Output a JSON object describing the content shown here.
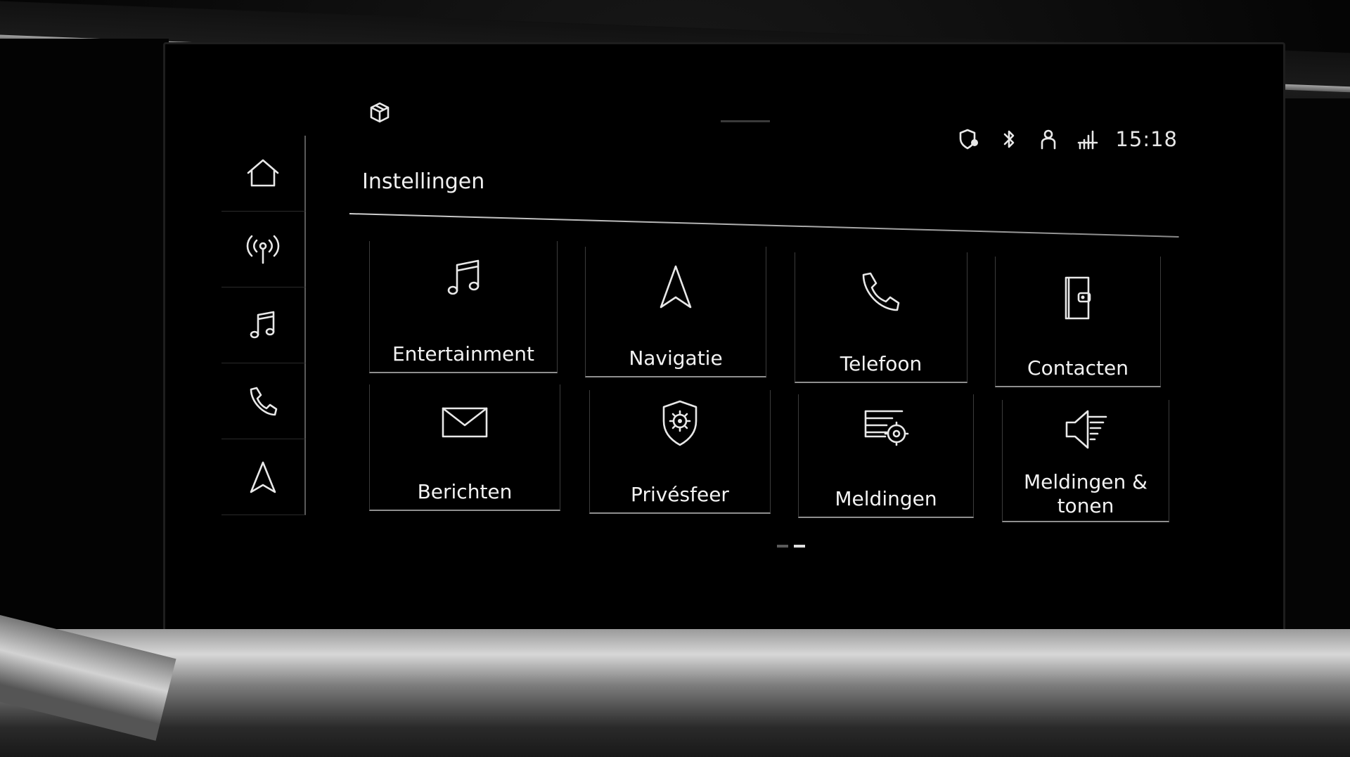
{
  "status_bar": {
    "clock": "15:18",
    "icons": [
      "location-shield-icon",
      "bluetooth-icon",
      "user-profile-icon",
      "lte-signal-icon"
    ]
  },
  "header": {
    "title": "Instellingen",
    "top_left_icon": "cube-icon"
  },
  "sidenav": {
    "items": [
      {
        "name": "home",
        "icon": "home-icon"
      },
      {
        "name": "radio",
        "icon": "radio-antenna-icon"
      },
      {
        "name": "media",
        "icon": "music-note-icon"
      },
      {
        "name": "phone",
        "icon": "phone-icon"
      },
      {
        "name": "navigation",
        "icon": "navigation-arrow-icon"
      }
    ]
  },
  "tiles": [
    {
      "label": "Entertainment",
      "icon": "music-note-icon"
    },
    {
      "label": "Navigatie",
      "icon": "navigation-arrow-icon"
    },
    {
      "label": "Telefoon",
      "icon": "phone-icon"
    },
    {
      "label": "Contacten",
      "icon": "contact-book-icon"
    },
    {
      "label": "Berichten",
      "icon": "envelope-icon"
    },
    {
      "label": "Privésfeer",
      "icon": "privacy-shield-gear-icon"
    },
    {
      "label": "Meldingen",
      "icon": "notification-gear-icon"
    },
    {
      "label": "Meldingen & tonen",
      "icon": "speaker-volume-icon"
    }
  ],
  "pager": {
    "pages": 2,
    "active": 2
  },
  "colors": {
    "screen_bg": "#000000",
    "text": "#f2f2f2",
    "divider": "#8f8f8f"
  }
}
